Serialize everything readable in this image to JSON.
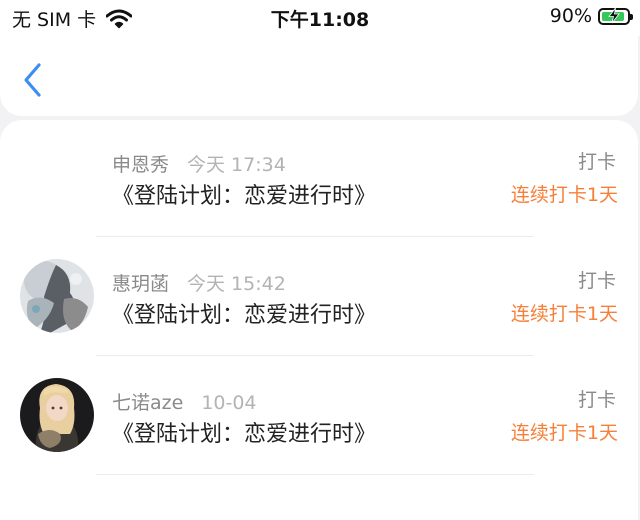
{
  "status_bar": {
    "carrier": "无 SIM 卡",
    "time": "下午11:08",
    "battery_percent": "90%",
    "battery_level": 0.9,
    "wifi_icon": "wifi-icon",
    "battery_icon": "battery-charging-icon"
  },
  "nav": {
    "back_icon": "chevron-left-icon",
    "accent_color": "#3d8ef0"
  },
  "colors": {
    "streak": "#f6803a",
    "muted": "#8a8a8a",
    "timestamp": "#b3b3b3"
  },
  "items": [
    {
      "name": "申恩秀",
      "time": "今天 17:34",
      "title": "《登陆计划：恋爱进行时》",
      "action": "打卡",
      "streak": "连续打卡1天",
      "has_avatar": false
    },
    {
      "name": "惠玥菡",
      "time": "今天 15:42",
      "title": "《登陆计划：恋爱进行时》",
      "action": "打卡",
      "streak": "连续打卡1天",
      "has_avatar": true
    },
    {
      "name": "七诺aze",
      "time": "10-04",
      "title": "《登陆计划：恋爱进行时》",
      "action": "打卡",
      "streak": "连续打卡1天",
      "has_avatar": true
    }
  ]
}
